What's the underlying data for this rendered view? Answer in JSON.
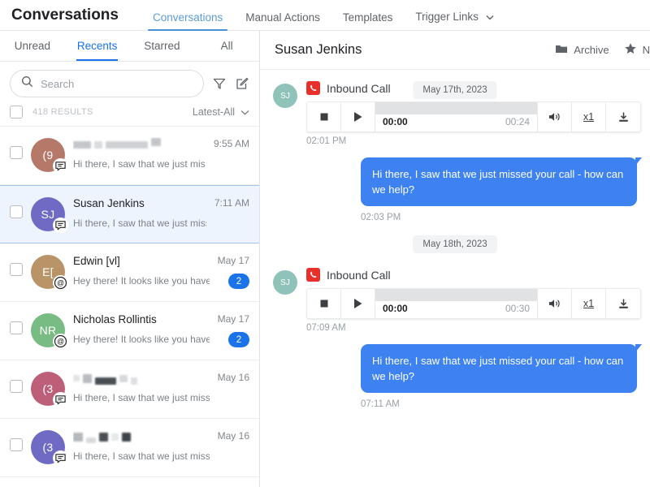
{
  "header": {
    "app_title": "Conversations",
    "nav": [
      {
        "label": "Conversations",
        "active": true,
        "caret": false
      },
      {
        "label": "Manual Actions",
        "active": false,
        "caret": false
      },
      {
        "label": "Templates",
        "active": false,
        "caret": false
      },
      {
        "label": "Trigger Links",
        "active": false,
        "caret": true
      }
    ],
    "caret_glyph": "⌄"
  },
  "sidebar": {
    "tabs": [
      {
        "label": "Unread",
        "active": false
      },
      {
        "label": "Recents",
        "active": true
      },
      {
        "label": "Starred",
        "active": false
      },
      {
        "label": "All",
        "active": false
      }
    ],
    "search": {
      "placeholder": "Search",
      "value": ""
    },
    "filter_icon": "filter-funnel-icon",
    "compose_icon": "compose-icon",
    "results_count": "418 RESULTS",
    "sort_label": "Latest-All",
    "conversations": [
      {
        "name": "",
        "redacted": true,
        "initials": "(9",
        "avatar_color": "#b5796a",
        "snippet": "Hi there, I saw that we just missed y..",
        "time": "9:55 AM",
        "badge": "",
        "channel_icon": "sms-icon"
      },
      {
        "name": "Susan Jenkins",
        "redacted": false,
        "initials": "SJ",
        "avatar_color": "#6f6ac4",
        "snippet": "Hi there, I saw that we just missed y..",
        "time": "7:11 AM",
        "badge": "",
        "channel_icon": "sms-icon",
        "selected": true
      },
      {
        "name": "Edwin [vl]",
        "redacted": false,
        "initials": "E[",
        "avatar_color": "#b99468",
        "snippet": "Hey there!  It looks like you haven'..",
        "time": "May 17",
        "badge": "2",
        "channel_icon": "email-icon"
      },
      {
        "name": "Nicholas Rollintis",
        "redacted": false,
        "initials": "NR",
        "avatar_color": "#78bb83",
        "snippet": "Hey there!  It looks like you haven'..",
        "time": "May 17",
        "badge": "2",
        "channel_icon": "email-icon"
      },
      {
        "name": "",
        "redacted": true,
        "initials": "(3",
        "avatar_color": "#bd5f79",
        "snippet": "Hi there, I saw that we just missed y..",
        "time": "May 16",
        "badge": "",
        "channel_icon": "sms-icon"
      },
      {
        "name": "",
        "redacted": true,
        "initials": "(3",
        "avatar_color": "#6f6ac4",
        "snippet": "Hi there, I saw that we just missed y..",
        "time": "May 16",
        "badge": "",
        "channel_icon": "sms-icon"
      }
    ]
  },
  "chat": {
    "title": "Susan Jenkins",
    "archive_label": "Archive",
    "star_label": "N",
    "contact_initials": "SJ",
    "dates": {
      "first": "May 17th, 2023",
      "second": "May 18th, 2023"
    },
    "calls": [
      {
        "label": "Inbound Call",
        "current_time": "00:00",
        "duration": "00:24",
        "speed": "x1",
        "timestamp": "02:01 PM"
      },
      {
        "label": "Inbound Call",
        "current_time": "00:00",
        "duration": "00:30",
        "speed": "x1",
        "timestamp": "07:09 AM"
      }
    ],
    "messages": [
      {
        "text": "Hi there, I saw that we just missed your call - how can we help?",
        "timestamp": "02:03 PM"
      },
      {
        "text": "Hi there, I saw that we just missed your call - how can we help?",
        "timestamp": "07:11 AM"
      }
    ]
  },
  "colors": {
    "accent_blue": "#1a73e8",
    "bubble_blue": "#3d82f0",
    "call_red": "#e8302a",
    "selected_row": "#eef4fd"
  }
}
